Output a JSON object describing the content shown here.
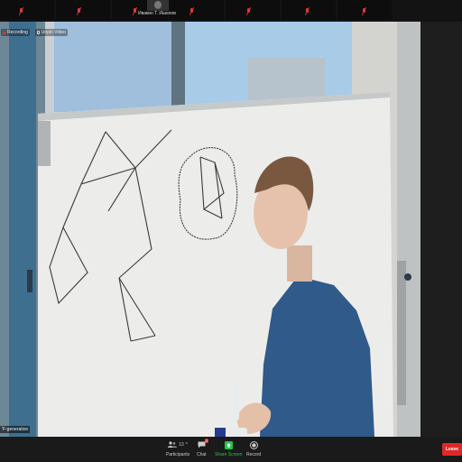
{
  "participant_strip": {
    "name_label": "Ивакин Т. Ишенов"
  },
  "recording_bar": {
    "recording_label": "Recording",
    "unpin_label": "Unpin Video"
  },
  "video": {
    "caption": "'F-generation"
  },
  "toolbar": {
    "participants_label": "Participants",
    "participants_count": "13",
    "chat_label": "Chat",
    "chat_badge": "3",
    "share_label": "Share Screen",
    "record_label": "Record",
    "leave_label": "Leave"
  },
  "colors": {
    "share_green": "#25c44a",
    "leave_red": "#e02828",
    "mic_muted_red": "#e53935"
  }
}
